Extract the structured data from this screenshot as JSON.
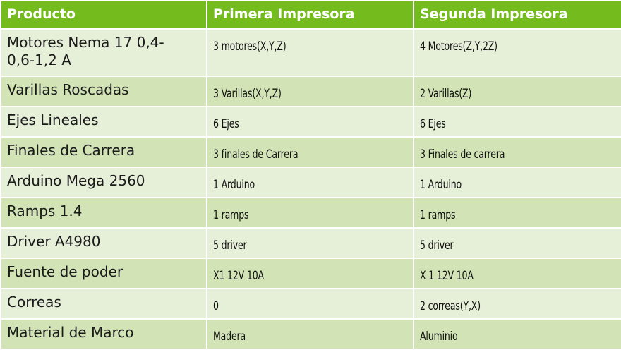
{
  "headers": [
    "Producto",
    "Primera Impresora",
    "Segunda Impresora"
  ],
  "rows": [
    {
      "producto": "Motores Nema 17 0,4-0,6-1,2 A",
      "primera": "3 motores(X,Y,Z)",
      "segunda": "4 Motores(Z,Y,2Z)"
    },
    {
      "producto": "Varillas Roscadas",
      "primera": "3 Varillas(X,Y,Z)",
      "segunda": "2 Varillas(Z)"
    },
    {
      "producto": "Ejes Lineales",
      "primera": "6 Ejes",
      "segunda": "6 Ejes"
    },
    {
      "producto": "Finales de Carrera",
      "primera": "3 finales de Carrera",
      "segunda": "3 Finales de carrera"
    },
    {
      "producto": "Arduino Mega 2560",
      "primera": "1 Arduino",
      "segunda": "1 Arduino"
    },
    {
      "producto": "Ramps 1.4",
      "primera": "1 ramps",
      "segunda": "1 ramps"
    },
    {
      "producto": "Driver A4980",
      "primera": "5 driver",
      "segunda": "5 driver"
    },
    {
      "producto": "Fuente de poder",
      "primera": "X1 12V 10A",
      "segunda": "X 1 12V 10A"
    },
    {
      "producto": "Correas",
      "primera": "0",
      "segunda": "2 correas(Y,X)"
    },
    {
      "producto": "Material de Marco",
      "primera": "Madera",
      "segunda": "Aluminio"
    }
  ],
  "colors": {
    "header_bg": "#74bc1d",
    "row_light": "#e6efd8",
    "row_dark": "#d2e4b6"
  }
}
